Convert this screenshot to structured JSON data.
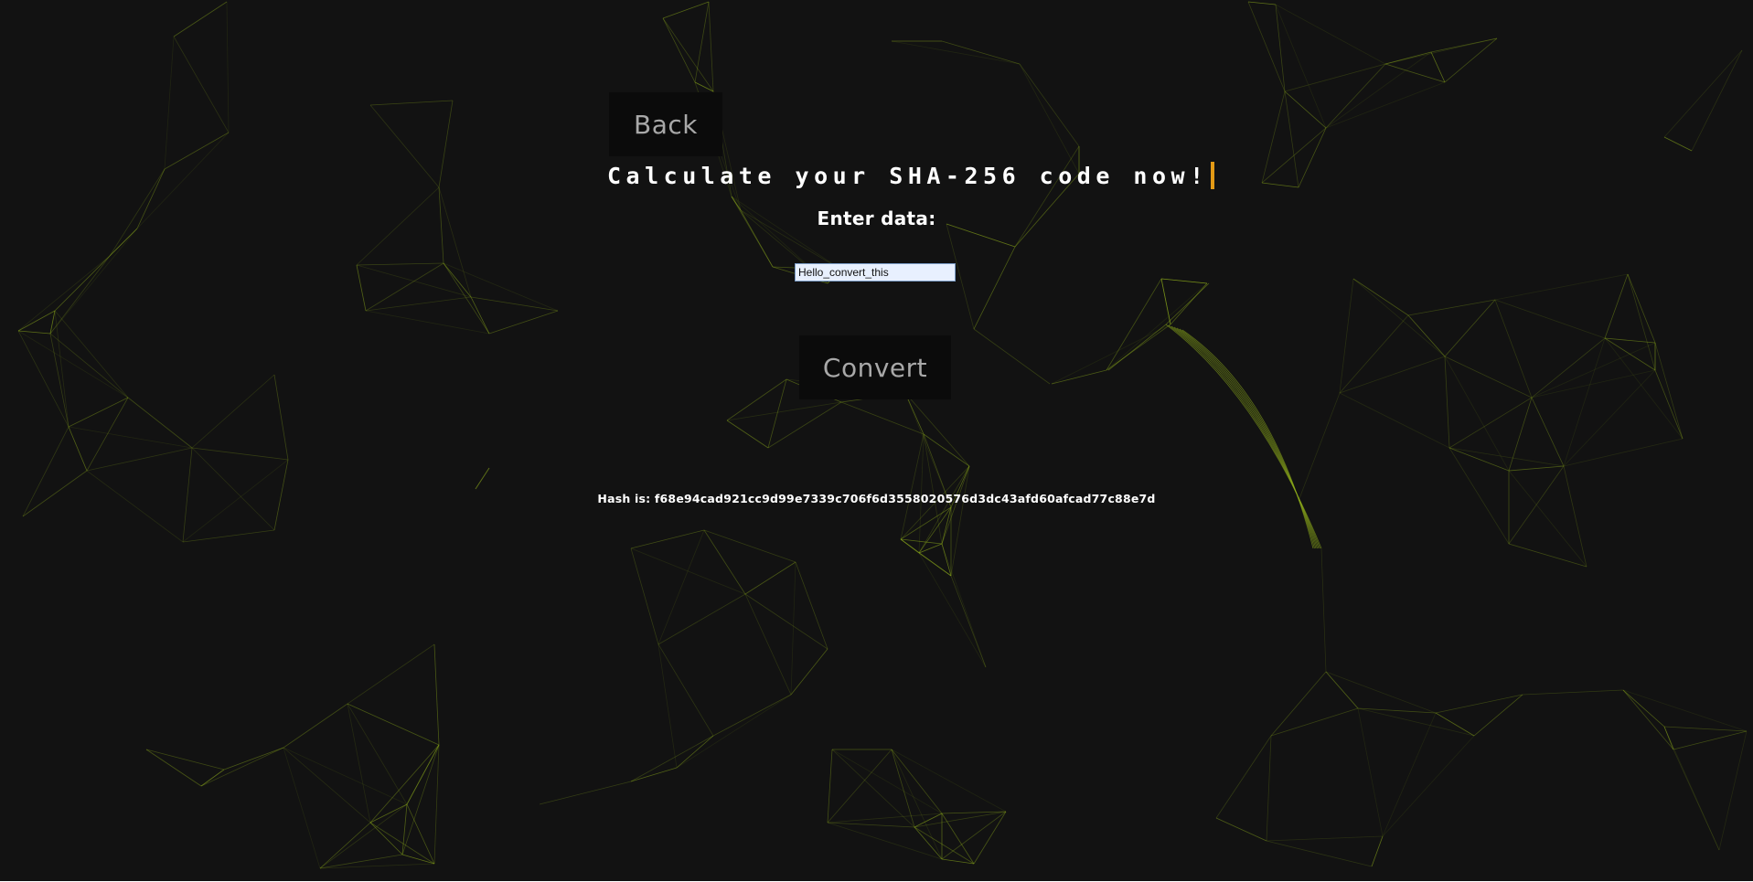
{
  "colors": {
    "background": "#121212",
    "network_line": "#8fae1b",
    "button_background": "#0b0b0b",
    "button_text": "#a8a8a8",
    "cursor": "#e39a15"
  },
  "nav": {
    "back_label": "Back"
  },
  "headline": {
    "text": "Calculate your SHA-256 code now!"
  },
  "form": {
    "label": "Enter data:",
    "input_value": "Hello_convert_this",
    "convert_label": "Convert"
  },
  "result": {
    "prefix": "Hash is: ",
    "hash": "f68e94cad921cc9d99e7339c706f6d3558020576d3dc43afd60afcad77c88e7d"
  },
  "background": {
    "decoration": "animated-particle-network"
  }
}
